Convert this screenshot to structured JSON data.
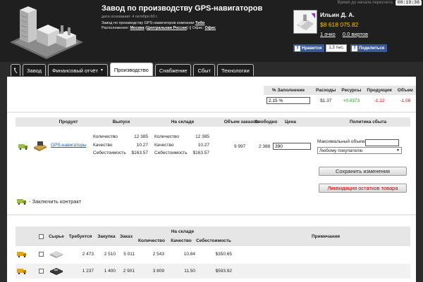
{
  "header": {
    "timer_label": "Время до начала пересчета",
    "timer": "08:19:36",
    "title": "Завод по производству GPS-навигаторов",
    "founded": "дата основания: 4 октября 60 г.",
    "company_prefix": "Завод по производству GPS-навигаторов компании",
    "company_name": "Тибо",
    "location_prefix": "Расположение:",
    "location_city": "Москва",
    "location_region": "Центральная Россия",
    "location_sep": "||",
    "office_prefix": "Офис:",
    "office_name": "Офис"
  },
  "user": {
    "name": "Ильин Д. А.",
    "money": "$8 618 075.82",
    "points": "1 очко",
    "virts": "0.0 виртов"
  },
  "social": {
    "like_label": "Нравится",
    "like_count": "1,3 тыс.",
    "share_label": "Поделиться"
  },
  "tabs": [
    {
      "label": "Завод"
    },
    {
      "label": "Финансовый отчёт",
      "dropdown": "▼"
    },
    {
      "label": "Производство"
    },
    {
      "label": "Снабжение"
    },
    {
      "label": "Сбыт"
    },
    {
      "label": "Технологии"
    }
  ],
  "stats": {
    "headers": [
      "% Заполнение",
      "Расходы",
      "Ресурсы",
      "Продукция",
      "Объем"
    ],
    "fill_value": "2.15 %",
    "expenses": "$1.37",
    "resources": "+0.0373",
    "production": "-1.12",
    "volume": "-1.08",
    "colors": {
      "positive": "#139a13",
      "negative": "#dd0000"
    }
  },
  "product_table": {
    "headers": {
      "product": "Продукт",
      "output": "Выпуск",
      "warehouse": "На складе",
      "orders": "Объем заказов",
      "free": "Свободно",
      "price": "Цена",
      "policy": "Политика сбыта"
    },
    "product_name": "GPS-навигаторы",
    "output": [
      {
        "label": "Количество",
        "value": "12 385"
      },
      {
        "label": "Качество",
        "value": "10.27"
      },
      {
        "label": "Себестоимость",
        "value": "$163.57"
      }
    ],
    "warehouse": [
      {
        "label": "Количество",
        "value": "12 385"
      },
      {
        "label": "Качество",
        "value": "10.27"
      },
      {
        "label": "Себестоимость",
        "value": "$163.57"
      }
    ],
    "orders": "9 997",
    "free": "2 388",
    "price": "390",
    "policy_label": "Максимальный объем:",
    "policy_option": "Любому покупателю",
    "save_button": "Сохранить изменения",
    "liquidate_button": "Ликвидация остатков товара"
  },
  "contract_label": "- Заключить контракт",
  "supply_table": {
    "headers": {
      "raw": "Сырье",
      "required": "Требуется",
      "purchase": "Закупка",
      "order": "Заказ",
      "warehouse": "На складе",
      "qty": "Количество",
      "quality": "Качество",
      "cost": "Себестоимость",
      "notes": "Примечания"
    },
    "rows": [
      {
        "required": "2 473",
        "purchase": "2 510",
        "order": "5 011",
        "qty": "2 543",
        "quality": "10.84",
        "cost": "$350.65"
      },
      {
        "required": "1 237",
        "purchase": "1 400",
        "order": "2 901",
        "qty": "3 809",
        "quality": "11.50",
        "cost": "$593.92"
      }
    ]
  }
}
